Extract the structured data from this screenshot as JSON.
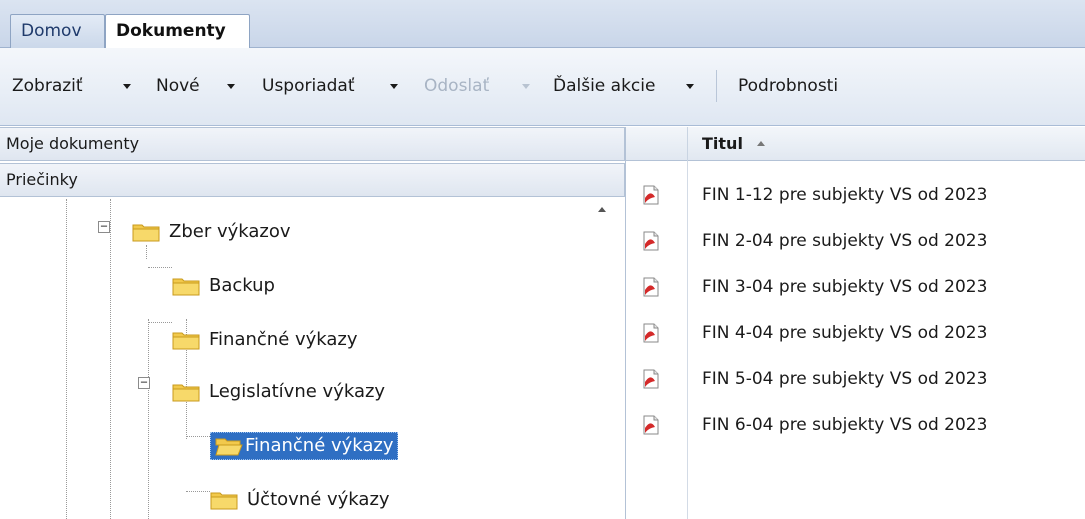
{
  "tabs": [
    {
      "label": "Domov",
      "active": false
    },
    {
      "label": "Dokumenty",
      "active": true
    }
  ],
  "toolbar": {
    "zobrazit": "Zobraziť",
    "nove": "Nové",
    "usporiadat": "Usporiadať",
    "odoslat": "Odoslať",
    "dalsie": "Ďalšie akcie",
    "podrobnosti": "Podrobnosti"
  },
  "left_pane": {
    "moje_dokumenty": "Moje dokumenty",
    "priecinky": "Priečinky",
    "tree": [
      {
        "label": "Zber výkazov",
        "expanded": true,
        "selected": false
      },
      {
        "label": "Backup",
        "expanded": false,
        "selected": false
      },
      {
        "label": "Finančné výkazy",
        "expanded": false,
        "selected": false
      },
      {
        "label": "Legislatívne výkazy",
        "expanded": true,
        "selected": false
      },
      {
        "label": "Finančné výkazy",
        "expanded": false,
        "selected": true
      },
      {
        "label": "Účtovné výkazy",
        "expanded": false,
        "selected": false
      }
    ]
  },
  "grid": {
    "column_title": "Titul",
    "sort": "ascending",
    "rows": [
      {
        "title": "FIN 1-12 pre subjekty VS od 2023",
        "icon": "pdf-document-icon"
      },
      {
        "title": "FIN 2-04 pre subjekty VS od 2023",
        "icon": "pdf-document-icon"
      },
      {
        "title": "FIN 3-04 pre subjekty VS od 2023",
        "icon": "pdf-document-icon"
      },
      {
        "title": "FIN 4-04 pre subjekty VS od 2023",
        "icon": "pdf-document-icon"
      },
      {
        "title": "FIN 5-04 pre subjekty VS od 2023",
        "icon": "pdf-document-icon"
      },
      {
        "title": "FIN 6-04 pre subjekty VS od 2023",
        "icon": "pdf-document-icon"
      }
    ]
  },
  "colors": {
    "selection": "#2f6fc3",
    "folder": "#f2c94c",
    "pdf_red": "#d42a2a"
  }
}
